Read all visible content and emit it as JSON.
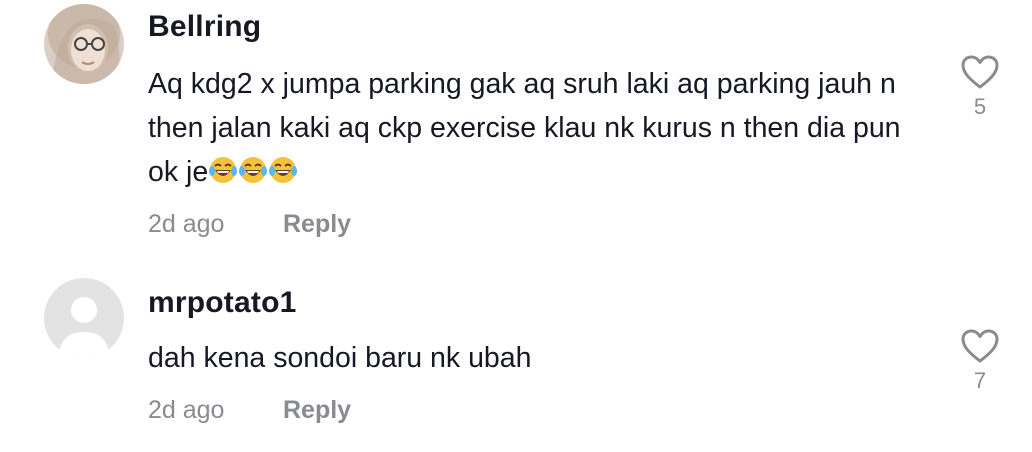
{
  "comments": [
    {
      "username": "Bellring",
      "text": "Aq kdg2 x jumpa parking gak aq sruh laki aq parking jauh n then jalan kaki aq ckp exercise klau nk kurus n then dia pun ok je",
      "emojis": [
        "face-with-tears-of-joy",
        "face-with-tears-of-joy",
        "face-with-tears-of-joy"
      ],
      "time": "2d ago",
      "reply_label": "Reply",
      "likes": "5",
      "avatar": "photo-avatar"
    },
    {
      "username": "mrpotato1",
      "text": "dah kena sondoi baru nk ubah",
      "time": "2d ago",
      "reply_label": "Reply",
      "likes": "7",
      "avatar": "default-avatar"
    }
  ],
  "colors": {
    "text": "#161823",
    "secondary": "#8a8b91",
    "like_icon": "#8a8b91",
    "default_avatar_bg": "#e3e3e4"
  }
}
